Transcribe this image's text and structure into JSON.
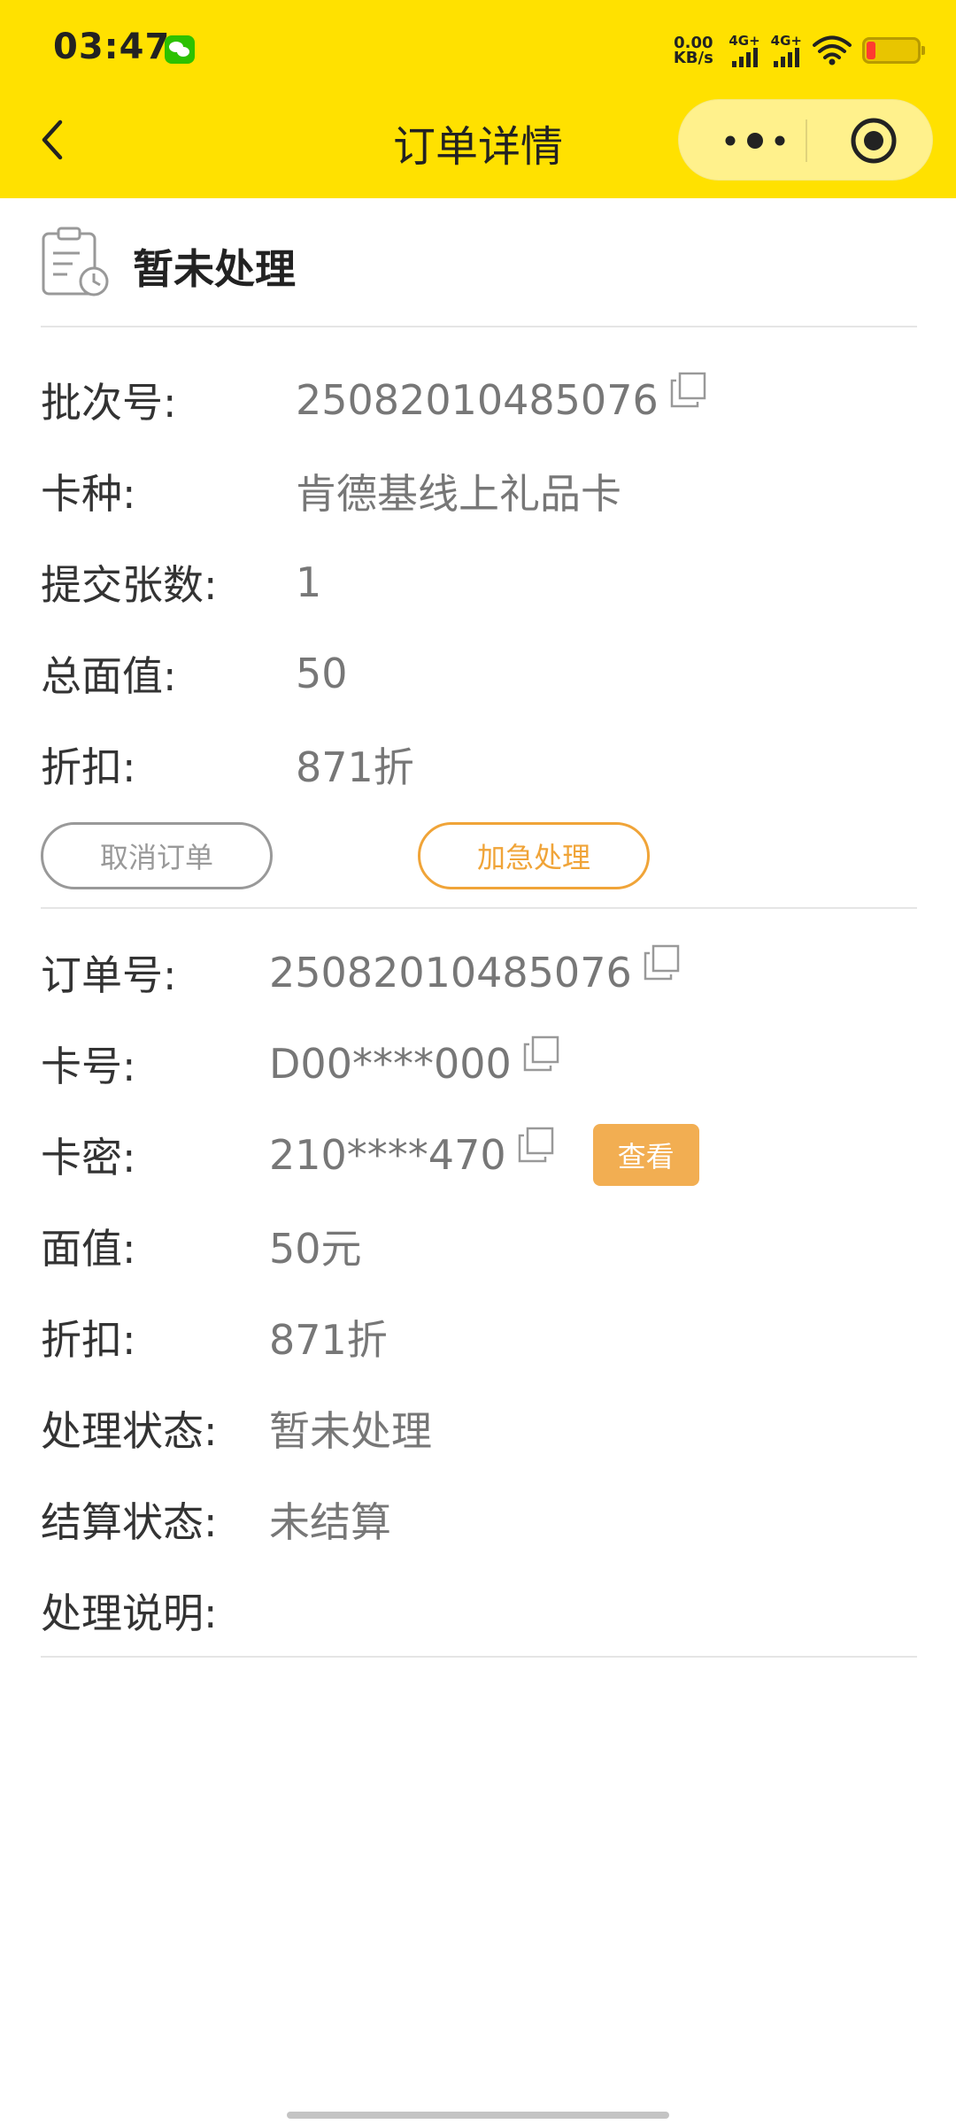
{
  "status_bar": {
    "time": "03:47",
    "net_speed_value": "0.00",
    "net_speed_unit": "KB/s",
    "signal1_label": "4G+",
    "signal2_label": "4G+"
  },
  "nav": {
    "title": "订单详情"
  },
  "order_status": {
    "text": "暂未处理"
  },
  "batch": {
    "batch_no_label": "批次号:",
    "batch_no": "25082010485076",
    "card_type_label": "卡种:",
    "card_type": "肯德基线上礼品卡",
    "count_label": "提交张数:",
    "count": "1",
    "total_label": "总面值:",
    "total": "50",
    "discount_label": "折扣:",
    "discount": "871折"
  },
  "actions": {
    "cancel_label": "取消订单",
    "urgent_label": "加急处理"
  },
  "order": {
    "order_no_label": "订单号:",
    "order_no": "25082010485076",
    "card_no_label": "卡号:",
    "card_no": "D00****000",
    "card_pwd_label": "卡密:",
    "card_pwd": "210****470",
    "view_label": "查看",
    "face_value_label": "面值:",
    "face_value": "50元",
    "discount_label": "折扣:",
    "discount": "871折",
    "process_status_label": "处理状态:",
    "process_status": "暂未处理",
    "settle_status_label": "结算状态:",
    "settle_status": "未结算",
    "remark_label": "处理说明:",
    "remark": ""
  },
  "colors": {
    "header": "#FFE100",
    "accent_orange": "#F0A438",
    "view_button": "#F2AE52"
  }
}
